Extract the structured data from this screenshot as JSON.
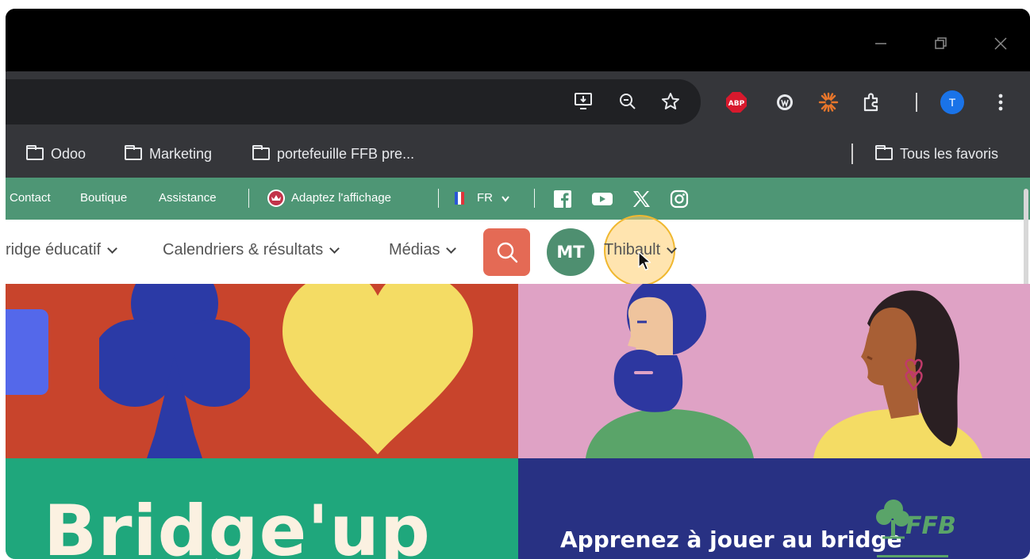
{
  "browser": {
    "bookmarks": [
      "Odoo",
      "Marketing",
      "portefeuille FFB pre..."
    ],
    "all_bookmarks": "Tous les favoris",
    "extensions": {
      "adblock_label": "ABP",
      "profile_initial": "T"
    },
    "colors": {
      "adblock": "#d8192d",
      "profile": "#1a73e8",
      "spark": "#e8762b"
    }
  },
  "site": {
    "topbar": {
      "links": [
        "Contact",
        "Boutique",
        "Assistance"
      ],
      "display_option": "Adaptez l'affichage",
      "language": "FR"
    },
    "nav": {
      "items": [
        "ridge éducatif",
        "Calendriers & résultats",
        "Médias"
      ],
      "avatar_initials": "MT",
      "user_name": "Thibault"
    },
    "hero": {
      "left_heading": "Bridge'up",
      "right_text": "Apprenez à jouer au bridge",
      "logo_text": "FFB"
    },
    "colors": {
      "topbar": "#4e9675",
      "search_button": "#e46a55",
      "avatar": "#4e8f70",
      "red_panel": "#c8442c",
      "pink_panel": "#dfa2c5",
      "green_panel": "#1fa77c",
      "navy_panel": "#283183"
    }
  }
}
